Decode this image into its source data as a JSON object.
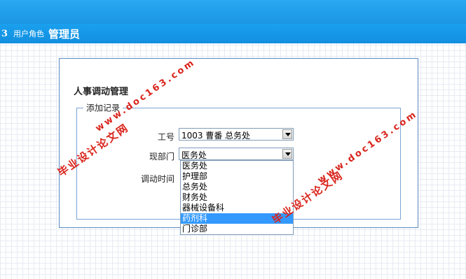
{
  "header": {
    "step_number": "3",
    "role_label": "用户角色",
    "role_value": "管理员"
  },
  "panel": {
    "title": "人事调动管理",
    "legend": "添加记录"
  },
  "form": {
    "employee_label": "工号",
    "employee_value": "1003 曹番 总务处",
    "department_label": "现部门",
    "department_value": "医务处",
    "date_label": "调动时间"
  },
  "department_options": [
    "医务处",
    "护理部",
    "总务处",
    "财务处",
    "器械设备科",
    "药剂科",
    "门诊部"
  ],
  "selected_option": "药剂科",
  "watermarks": {
    "cn": "毕业设计论文网",
    "en": "www.doc163.com"
  },
  "colors": {
    "header_blue": "#1a96e4",
    "panel_border": "#5b8bc3",
    "selection": "#3399ff",
    "watermark_red": "#d9241b"
  }
}
